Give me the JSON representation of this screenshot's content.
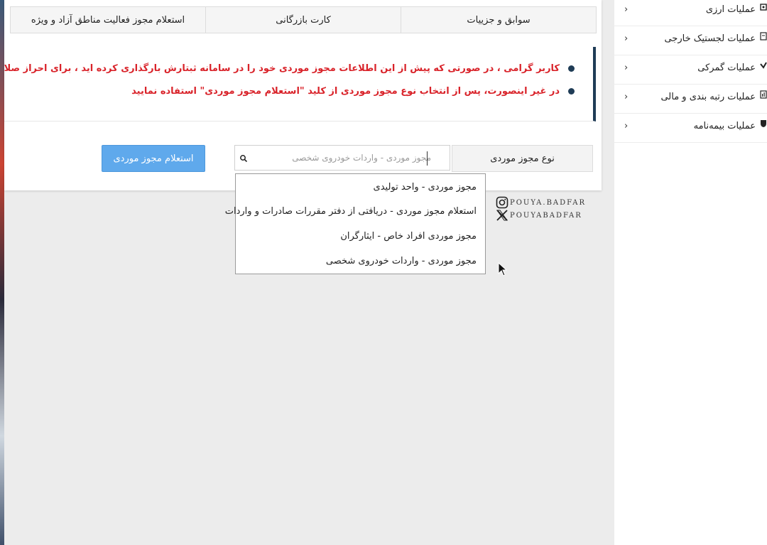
{
  "tabs": [
    {
      "label": "سوابق و جزییات"
    },
    {
      "label": "کارت بازرگانی"
    },
    {
      "label": "استعلام مجوز فعالیت مناطق آزاد و ویژه"
    }
  ],
  "notice": {
    "line1": "کاربر گرامی ، در صورتی که پیش از این اطلاعات مجوز موردی خود را در سامانه ثبتارش بارگذاری کرده اید ، برای احراز صلاحیت مجوز موردی خود",
    "line2": "در غیر اینصورت، پس از انتخاب نوع مجوز موردی از کلید \"استعلام مجوز موردی\" استفاده نمایید"
  },
  "form": {
    "license_type_label": "نوع مجوز موردی",
    "license_type_value": "مجوز موردی - واردات خودروی شخصی",
    "inquiry_button": "استعلام مجوز موردی"
  },
  "dropdown": {
    "options": [
      "مجوز موردی - واحد تولیدی",
      "استعلام مجوز موردی - دریافتی از دفتر مقررات صادرات و واردات",
      "مجوز موردی افراد خاص - ایثارگران",
      "مجوز موردی - واردات خودروی شخصی"
    ]
  },
  "watermark": {
    "instagram": "POUYA.BADFAR",
    "x": "POUYABADFAR"
  },
  "sidebar": {
    "items": [
      {
        "label": "عملیات ارزی",
        "icon": "currency-icon"
      },
      {
        "label": "عملیات لجستیک خارجی",
        "icon": "logistics-icon"
      },
      {
        "label": "عملیات گمرکی",
        "icon": "customs-icon"
      },
      {
        "label": "عملیات رتبه بندی و مالی",
        "icon": "chart-icon"
      },
      {
        "label": "عملیات بیمه‌نامه",
        "icon": "shield-icon"
      }
    ]
  },
  "colors": {
    "notice_text": "#d9232a",
    "accent_dark": "#1f3c56",
    "button_blue": "#5fa9ec"
  }
}
